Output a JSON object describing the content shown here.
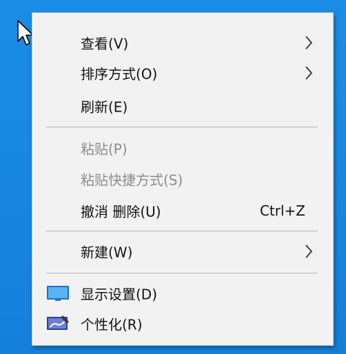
{
  "context_menu": {
    "items": [
      {
        "label": "查看(V)",
        "submenu": true,
        "disabled": false
      },
      {
        "label": "排序方式(O)",
        "submenu": true,
        "disabled": false
      },
      {
        "label": "刷新(E)",
        "submenu": false,
        "disabled": false
      },
      {
        "label": "粘贴(P)",
        "submenu": false,
        "disabled": true
      },
      {
        "label": "粘贴快捷方式(S)",
        "submenu": false,
        "disabled": true
      },
      {
        "label": "撤消 删除(U)",
        "shortcut": "Ctrl+Z",
        "submenu": false,
        "disabled": false
      },
      {
        "label": "新建(W)",
        "submenu": true,
        "disabled": false
      },
      {
        "label": "显示设置(D)",
        "icon": "display-settings-icon",
        "submenu": false,
        "disabled": false
      },
      {
        "label": "个性化(R)",
        "icon": "personalize-icon",
        "submenu": false,
        "disabled": false
      }
    ]
  },
  "colors": {
    "desktop": "#1684e0",
    "menu_background": "#f2f2f2",
    "text": "#111111",
    "disabled_text": "#8c8c8c",
    "separator": "#b5b5b5"
  },
  "icons": {
    "cursor": "mouse-pointer-icon",
    "submenu": "chevron-right-icon"
  }
}
